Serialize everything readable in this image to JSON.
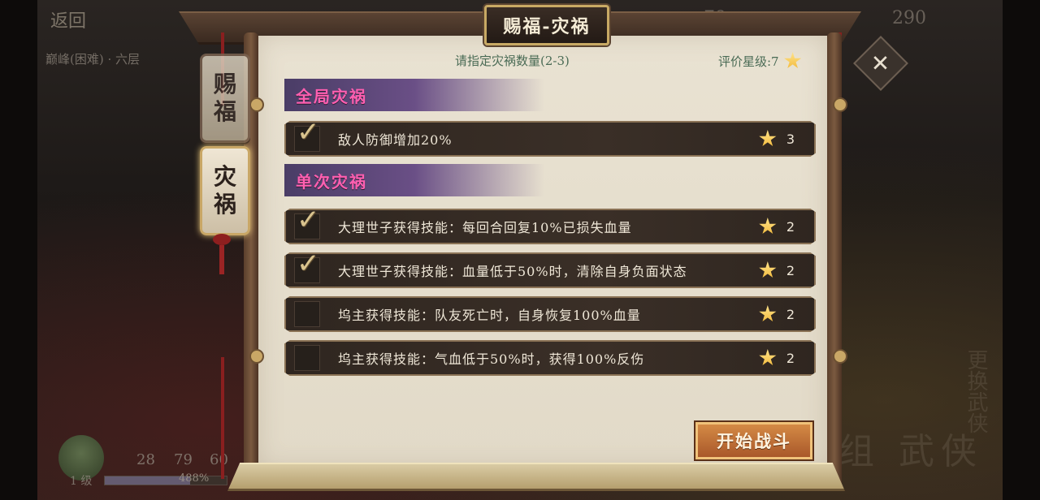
{
  "background": {
    "back_label": "返回",
    "stage_label": "巅峰(困难) · 六层",
    "top_value_1": "79",
    "top_value_2": "290",
    "stats": [
      "28",
      "79",
      "60"
    ],
    "level_label": "1 级",
    "exp_text": "488%",
    "right_deco": "卡组  武侠",
    "right_deco2": "更换武侠"
  },
  "panel": {
    "title": "赐福-灾祸",
    "instruction": "请指定灾祸数量(2-3)",
    "rating_label": "评价星级:7",
    "close_symbol": "✕"
  },
  "side_tabs": [
    {
      "label_top": "赐",
      "label_bottom": "福",
      "selected": false
    },
    {
      "label_top": "灾",
      "label_bottom": "祸",
      "selected": true
    }
  ],
  "sections": [
    {
      "title": "全局灾祸",
      "rows": [
        {
          "text": "敌人防御增加20%",
          "stars": "3",
          "checked": true
        }
      ]
    },
    {
      "title": "单次灾祸",
      "rows": [
        {
          "text": "大理世子获得技能：每回合回复10%已损失血量",
          "stars": "2",
          "checked": true
        },
        {
          "text": "大理世子获得技能：血量低于50%时，清除自身负面状态",
          "stars": "2",
          "checked": true
        },
        {
          "text": "坞主获得技能：队友死亡时，自身恢复100%血量",
          "stars": "2",
          "checked": false
        },
        {
          "text": "坞主获得技能：气血低于50%时，获得100%反伤",
          "stars": "2",
          "checked": false
        }
      ]
    }
  ],
  "start_button": "开始战斗",
  "colors": {
    "accent_section_text": "#ff5fb0",
    "header_text": "#4a6b55"
  }
}
